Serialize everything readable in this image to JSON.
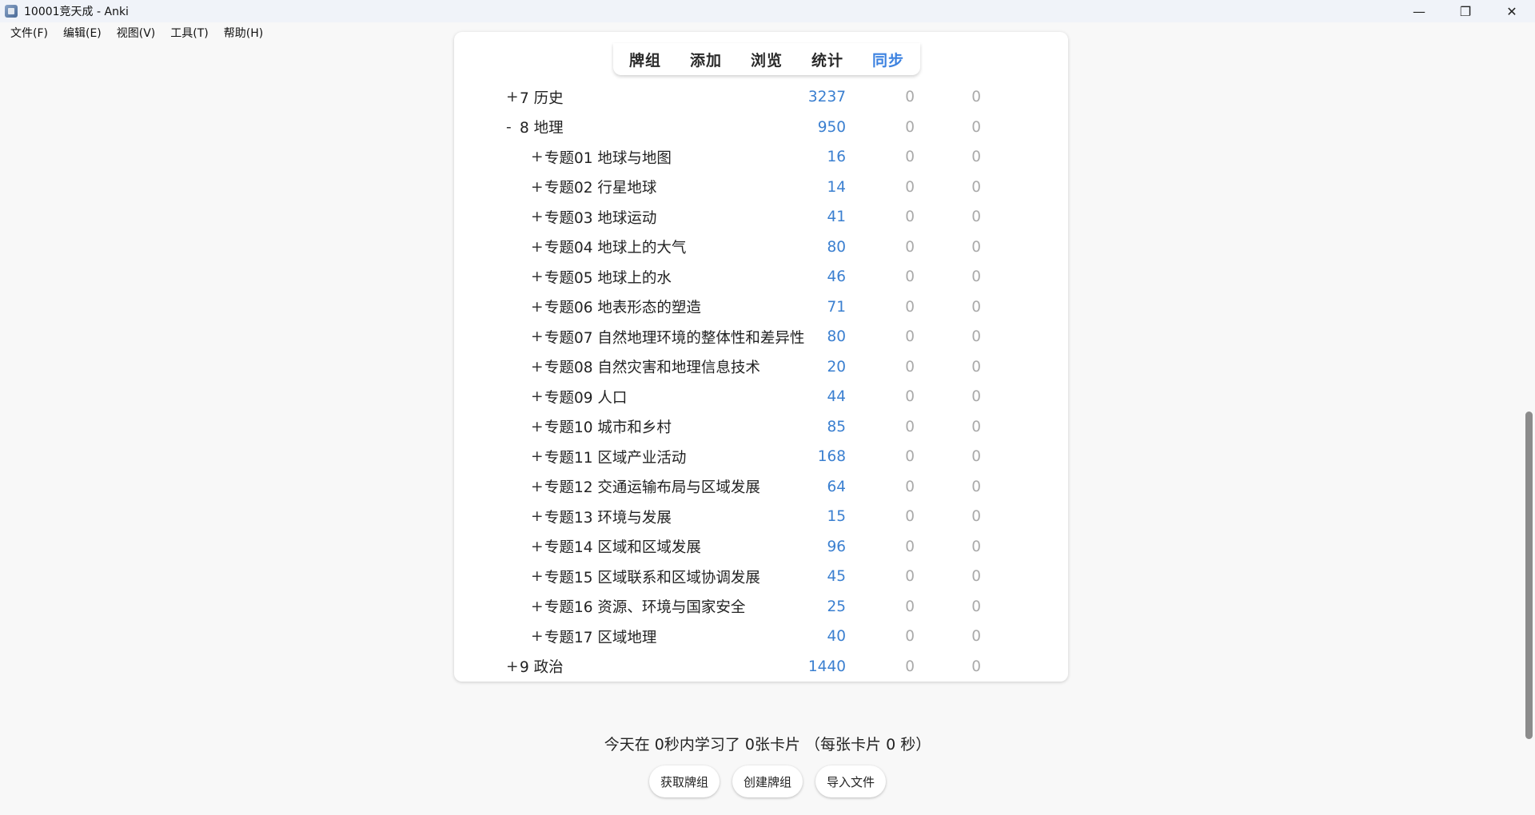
{
  "window": {
    "title": "10001竞天成 - Anki",
    "minimize_glyph": "—",
    "restore_glyph": "❐",
    "close_glyph": "✕"
  },
  "menu": [
    {
      "label": "文件(F)"
    },
    {
      "label": "编辑(E)"
    },
    {
      "label": "视图(V)"
    },
    {
      "label": "工具(T)"
    },
    {
      "label": "帮助(H)"
    }
  ],
  "nav": [
    {
      "label": "牌组",
      "active": false
    },
    {
      "label": "添加",
      "active": false
    },
    {
      "label": "浏览",
      "active": false
    },
    {
      "label": "统计",
      "active": false
    },
    {
      "label": "同步",
      "active": true
    }
  ],
  "decks": [
    {
      "toggle": "+",
      "name": "7 历史",
      "new": "3237",
      "learn": "0",
      "due": "0",
      "level": 0
    },
    {
      "toggle": "-",
      "name": "8 地理",
      "new": "950",
      "learn": "0",
      "due": "0",
      "level": 0
    },
    {
      "toggle": "+",
      "name": "专题01 地球与地图",
      "new": "16",
      "learn": "0",
      "due": "0",
      "level": 1
    },
    {
      "toggle": "+",
      "name": "专题02 行星地球",
      "new": "14",
      "learn": "0",
      "due": "0",
      "level": 1
    },
    {
      "toggle": "+",
      "name": "专题03 地球运动",
      "new": "41",
      "learn": "0",
      "due": "0",
      "level": 1
    },
    {
      "toggle": "+",
      "name": "专题04 地球上的大气",
      "new": "80",
      "learn": "0",
      "due": "0",
      "level": 1
    },
    {
      "toggle": "+",
      "name": "专题05 地球上的水",
      "new": "46",
      "learn": "0",
      "due": "0",
      "level": 1
    },
    {
      "toggle": "+",
      "name": "专题06 地表形态的塑造",
      "new": "71",
      "learn": "0",
      "due": "0",
      "level": 1
    },
    {
      "toggle": "+",
      "name": "专题07 自然地理环境的整体性和差异性",
      "new": "80",
      "learn": "0",
      "due": "0",
      "level": 1
    },
    {
      "toggle": "+",
      "name": "专题08 自然灾害和地理信息技术",
      "new": "20",
      "learn": "0",
      "due": "0",
      "level": 1
    },
    {
      "toggle": "+",
      "name": "专题09 人口",
      "new": "44",
      "learn": "0",
      "due": "0",
      "level": 1
    },
    {
      "toggle": "+",
      "name": "专题10 城市和乡村",
      "new": "85",
      "learn": "0",
      "due": "0",
      "level": 1
    },
    {
      "toggle": "+",
      "name": "专题11 区域产业活动",
      "new": "168",
      "learn": "0",
      "due": "0",
      "level": 1
    },
    {
      "toggle": "+",
      "name": "专题12 交通运输布局与区域发展",
      "new": "64",
      "learn": "0",
      "due": "0",
      "level": 1
    },
    {
      "toggle": "+",
      "name": "专题13 环境与发展",
      "new": "15",
      "learn": "0",
      "due": "0",
      "level": 1
    },
    {
      "toggle": "+",
      "name": "专题14 区域和区域发展",
      "new": "96",
      "learn": "0",
      "due": "0",
      "level": 1
    },
    {
      "toggle": "+",
      "name": "专题15 区域联系和区域协调发展",
      "new": "45",
      "learn": "0",
      "due": "0",
      "level": 1
    },
    {
      "toggle": "+",
      "name": "专题16 资源、环境与国家安全",
      "new": "25",
      "learn": "0",
      "due": "0",
      "level": 1
    },
    {
      "toggle": "+",
      "name": "专题17 区域地理",
      "new": "40",
      "learn": "0",
      "due": "0",
      "level": 1
    },
    {
      "toggle": "+",
      "name": "9 政治",
      "new": "1440",
      "learn": "0",
      "due": "0",
      "level": 0
    }
  ],
  "summary": "今天在 0秒内学习了 0张卡片 （每张卡片 0 秒）",
  "buttons": {
    "get_shared": "获取牌组",
    "create_deck": "创建牌组",
    "import_file": "导入文件"
  },
  "colors": {
    "accent": "#3c82e0",
    "new_count": "#3a7fd0",
    "zero_count": "#aaaaaa"
  }
}
